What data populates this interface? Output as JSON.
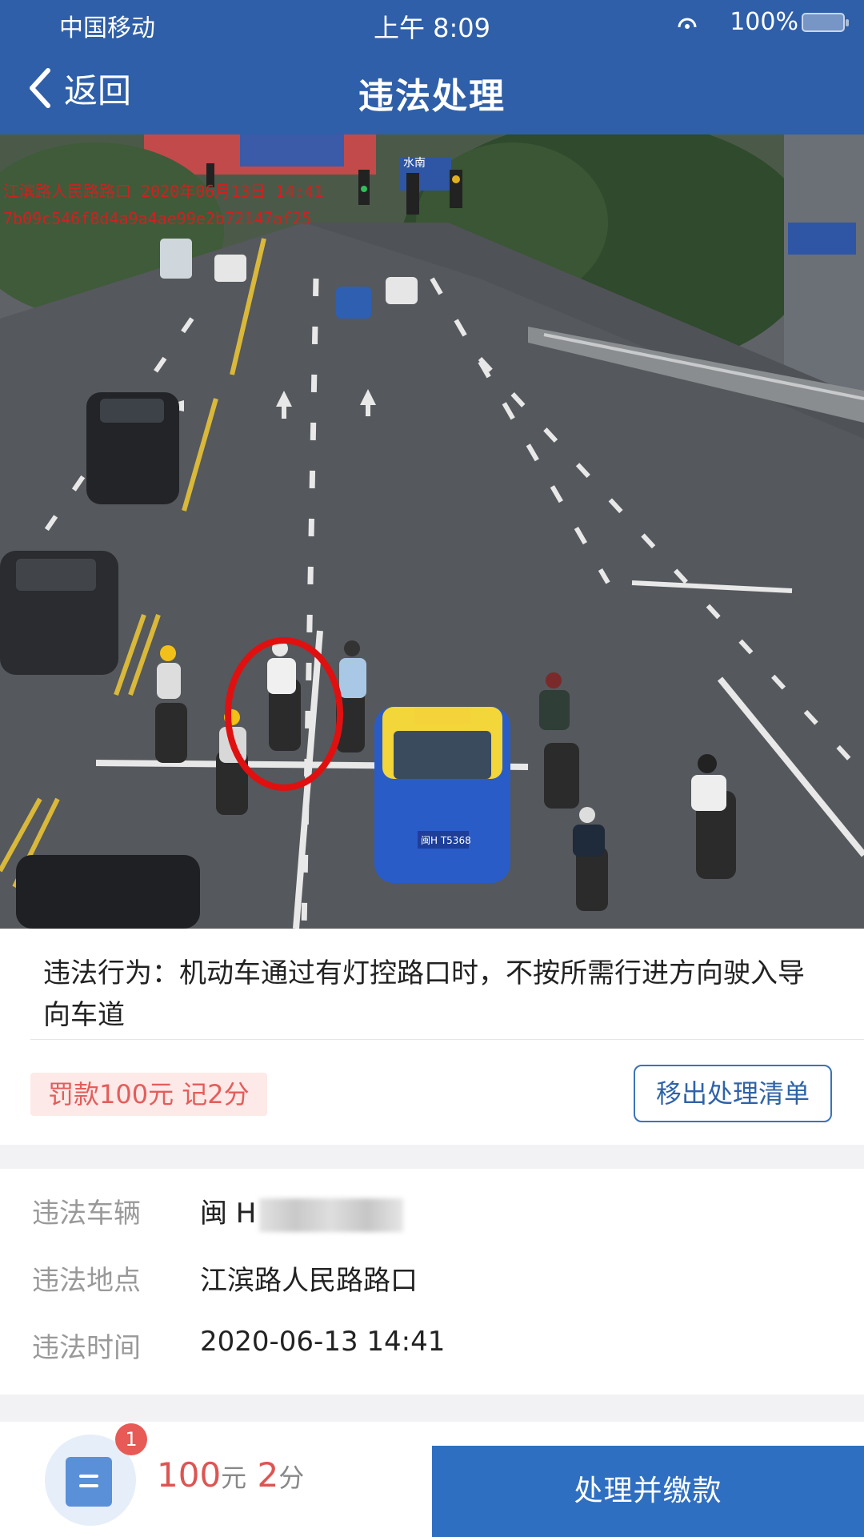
{
  "status_bar": {
    "carrier": "中国移动",
    "time": "上午 8:09",
    "battery": "100%"
  },
  "nav": {
    "back_label": "返回",
    "title": "违法处理"
  },
  "photo": {
    "overlay_line1": "江滨路人民路路口  2020年06月13日  14:41",
    "overlay_line2": "7b09c546f8d4a9a4ae99e2b72147af25",
    "taxi_plate": "闽H T5368",
    "sign_text": "水南"
  },
  "violation": {
    "behavior": "违法行为：机动车通过有灯控路口时，不按所需行进方向驶入导向车道",
    "fine_badge": "罚款100元 记2分",
    "remove_button": "移出处理清单"
  },
  "details": [
    {
      "label": "违法车辆",
      "value": "闽 H"
    },
    {
      "label": "违法地点",
      "value": "江滨路人民路路口"
    },
    {
      "label": "违法时间",
      "value": "2020-06-13 14:41"
    }
  ],
  "bottom": {
    "badge_count": "1",
    "amount": "100",
    "amount_unit": "元",
    "points": "2",
    "points_unit": "分",
    "pay_button": "处理并缴款"
  },
  "colors": {
    "header": "#2f5fa8",
    "accent_red": "#e35d5b",
    "pay_button": "#2f6fc2"
  }
}
